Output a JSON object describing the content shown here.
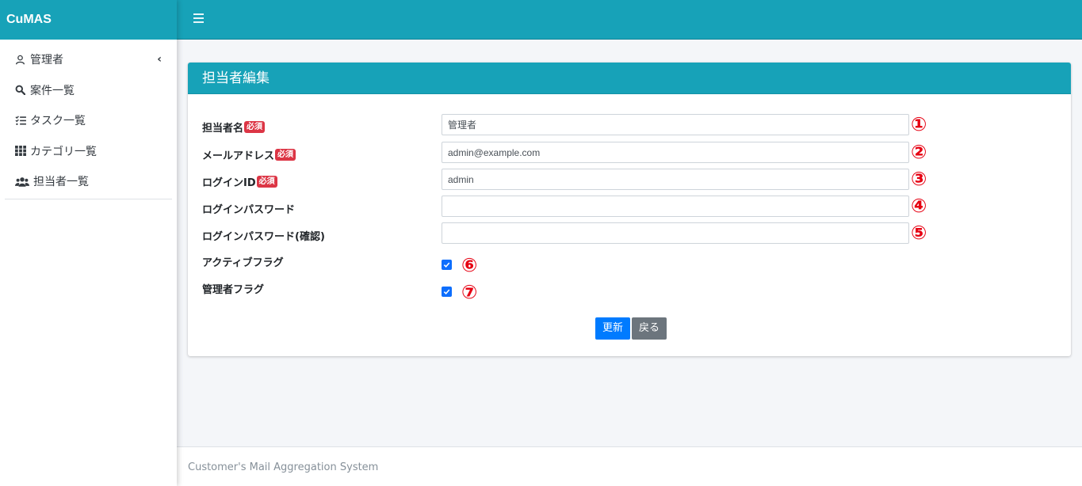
{
  "brand": "CuMAS",
  "sidebar": {
    "items": [
      {
        "label": "管理者",
        "icon": "user-icon",
        "chevron": "‹"
      },
      {
        "label": "案件一覧",
        "icon": "search-icon"
      },
      {
        "label": "タスク一覧",
        "icon": "tasks-icon"
      },
      {
        "label": "カテゴリ一覧",
        "icon": "grid-icon"
      },
      {
        "label": "担当者一覧",
        "icon": "users-icon"
      }
    ]
  },
  "card": {
    "title": "担当者編集",
    "required_badge": "必須",
    "fields": [
      {
        "label": "担当者名",
        "value": "管理者",
        "marker": "①"
      },
      {
        "label": "メールアドレス",
        "value": "admin@example.com",
        "marker": "②"
      },
      {
        "label": "ログインID",
        "value": "admin",
        "marker": "③"
      },
      {
        "label": "ログインパスワード",
        "value": "",
        "marker": "④"
      },
      {
        "label": "ログインパスワード(確認)",
        "value": "",
        "marker": "⑤"
      },
      {
        "label": "アクティブフラグ",
        "checked": true,
        "marker": "⑥"
      },
      {
        "label": "管理者フラグ",
        "checked": true,
        "marker": "⑦"
      }
    ],
    "update_button": "更新",
    "back_button": "戻る"
  },
  "footer": "Customer's Mail Aggregation System",
  "colors": {
    "accent": "#17a2b8",
    "required": "#dc3545",
    "marker": "#e60012",
    "primary": "#007bff",
    "secondary": "#6c757d"
  }
}
